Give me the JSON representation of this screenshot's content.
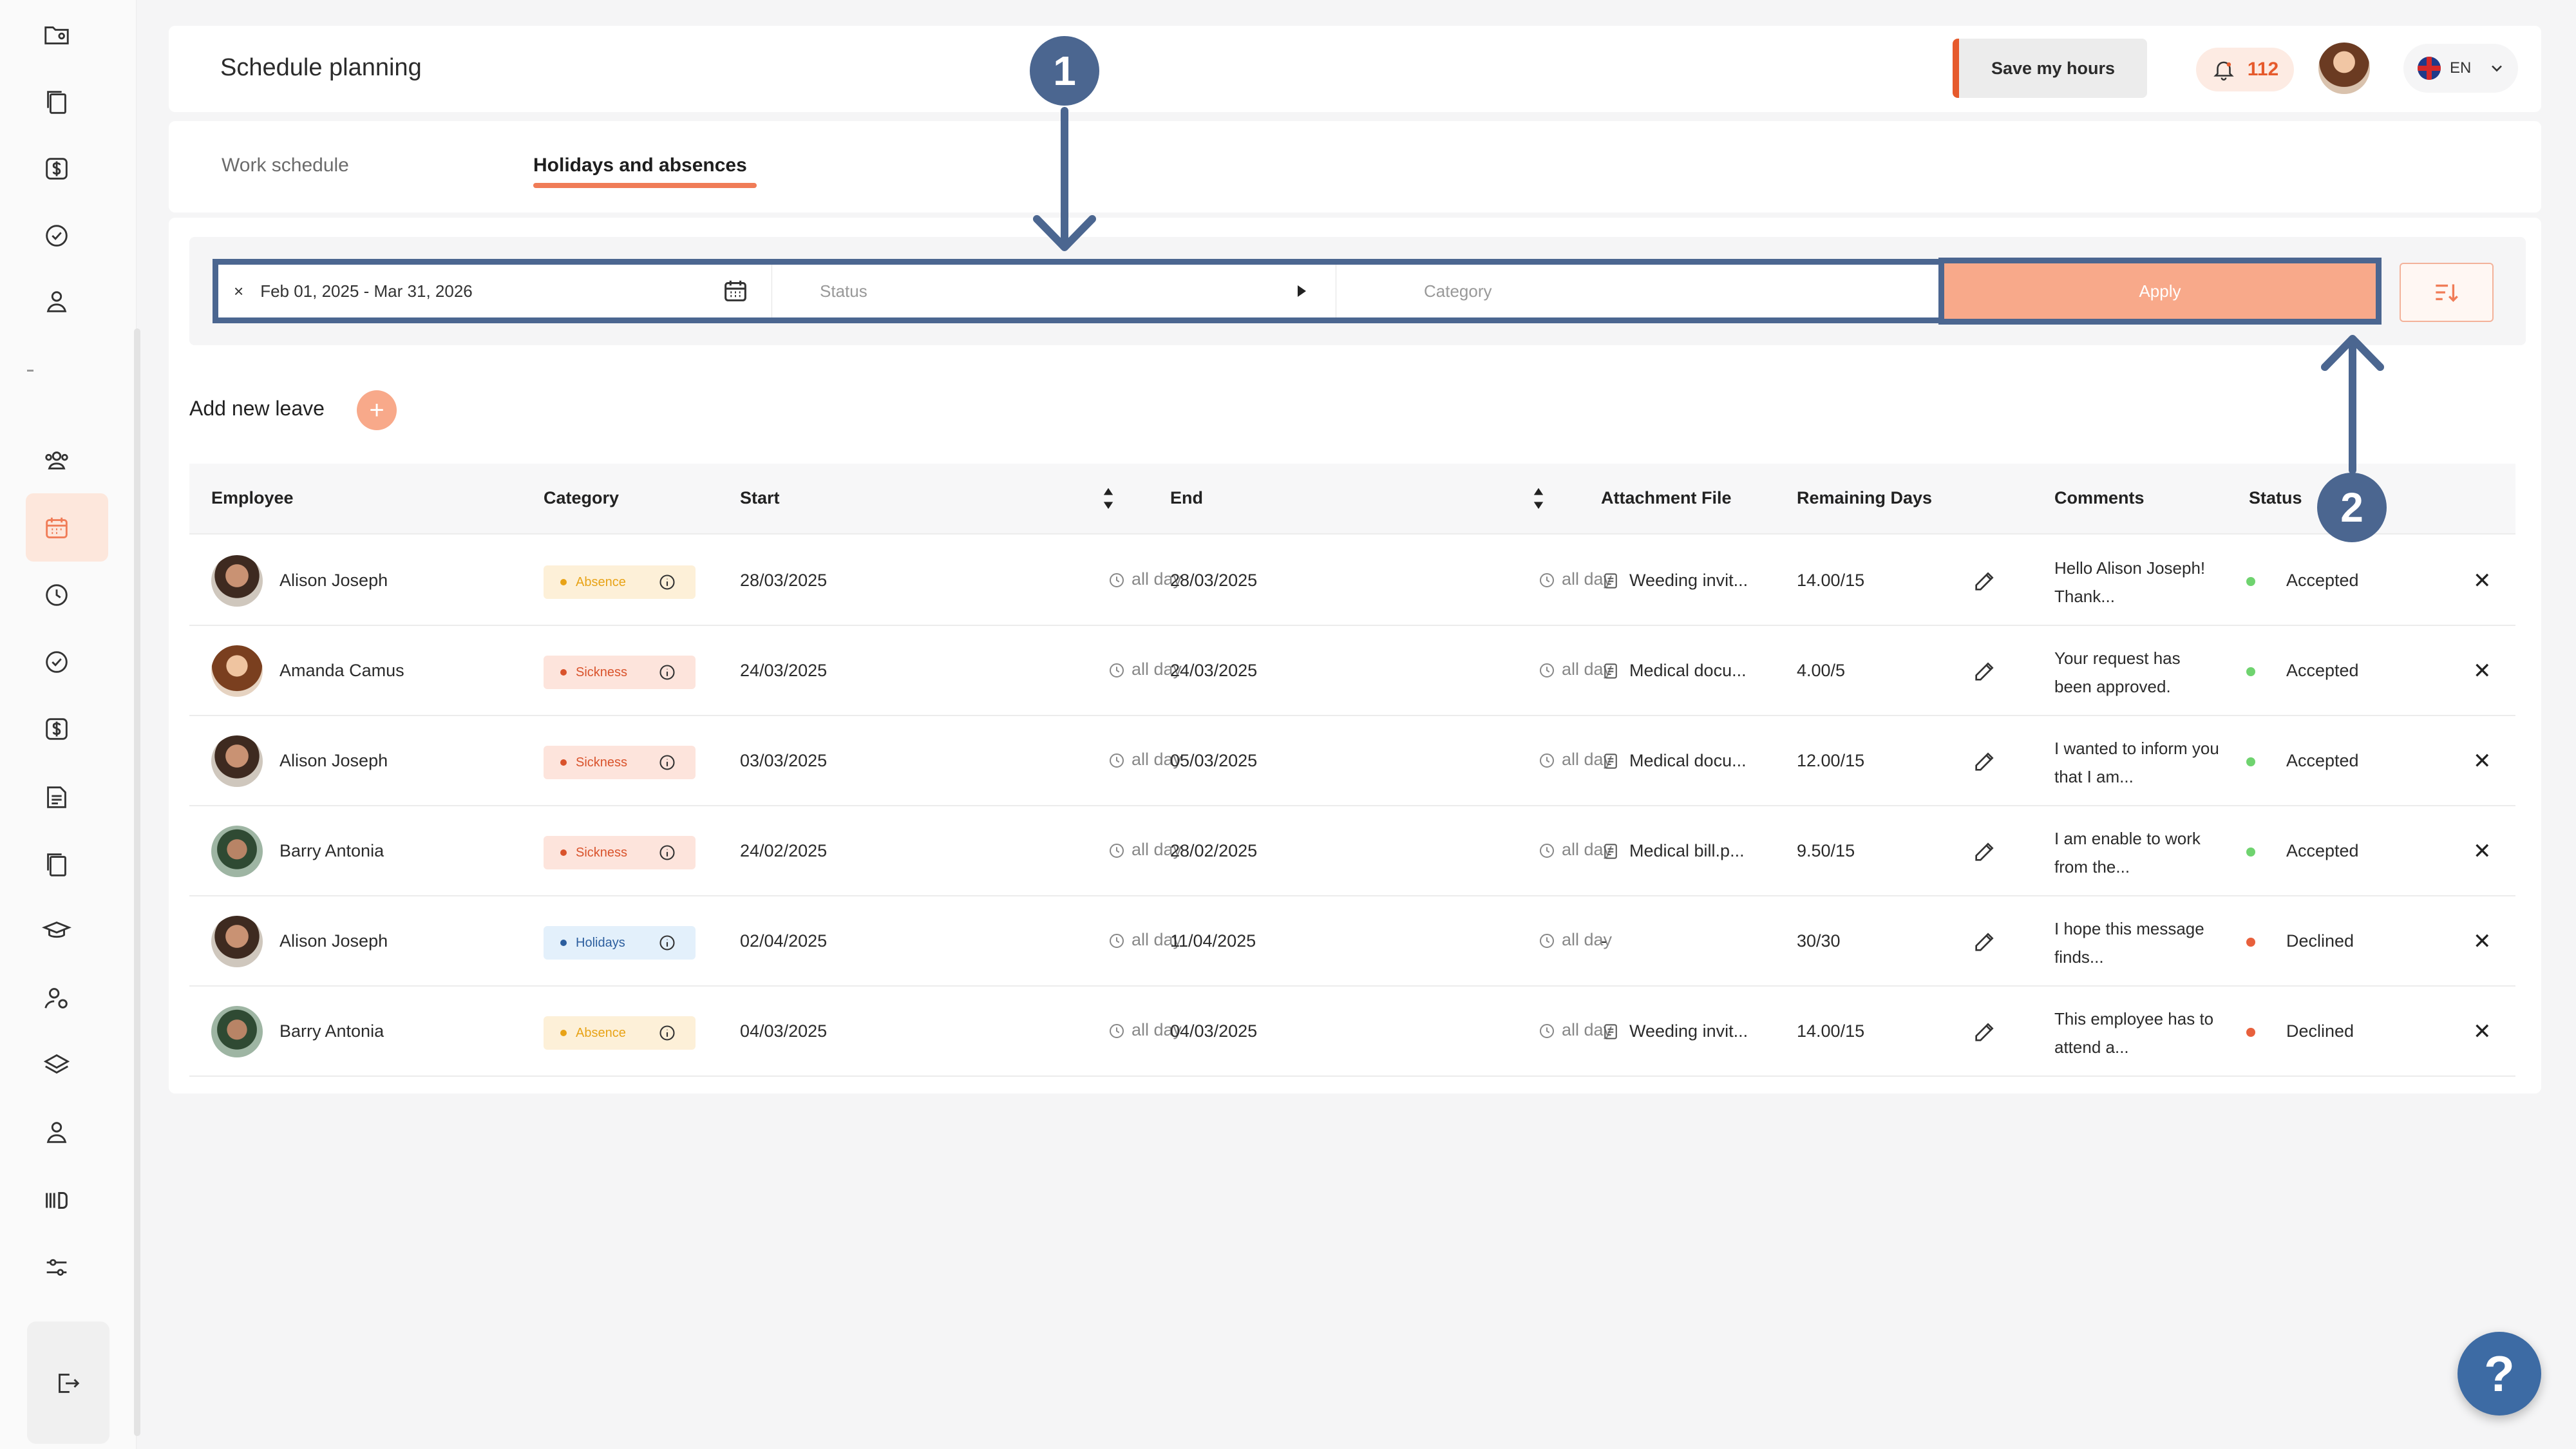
{
  "header": {
    "title": "Schedule planning",
    "save_hours_label": "Save my hours",
    "notification_count": "112",
    "language": "EN"
  },
  "tabs": [
    {
      "label": "Work schedule",
      "active": false
    },
    {
      "label": "Holidays and absences",
      "active": true
    }
  ],
  "filters": {
    "date_range": "Feb 01, 2025 - Mar 31, 2026",
    "status_placeholder": "Status",
    "category_placeholder": "Category",
    "apply_label": "Apply"
  },
  "add_leave_label": "Add new leave",
  "table": {
    "columns": [
      "Employee",
      "Category",
      "Start",
      "End",
      "Attachment File",
      "Remaining Days",
      "Comments",
      "Status"
    ],
    "rows": [
      {
        "employee": "Alison Joseph",
        "category": "Absence",
        "start": "28/03/2025",
        "start_time": "all day",
        "end": "28/03/2025",
        "end_time": "all day",
        "file": "Weeding invit...",
        "remaining": "14.00/15",
        "comment": "Hello Alison Joseph! Thank...",
        "status": "Accepted"
      },
      {
        "employee": "Amanda Camus",
        "category": "Sickness",
        "start": "24/03/2025",
        "start_time": "all day",
        "end": "24/03/2025",
        "end_time": "all day",
        "file": "Medical docu...",
        "remaining": "4.00/5",
        "comment": "Your request has been approved.",
        "status": "Accepted"
      },
      {
        "employee": "Alison Joseph",
        "category": "Sickness",
        "start": "03/03/2025",
        "start_time": "all day",
        "end": "05/03/2025",
        "end_time": "all day",
        "file": "Medical docu...",
        "remaining": "12.00/15",
        "comment": "I wanted to inform you that I am...",
        "status": "Accepted"
      },
      {
        "employee": "Barry Antonia",
        "category": "Sickness",
        "start": "24/02/2025",
        "start_time": "all day",
        "end": "28/02/2025",
        "end_time": "all day",
        "file": "Medical bill.p...",
        "remaining": "9.50/15",
        "comment": "I am enable to work from the...",
        "status": "Accepted"
      },
      {
        "employee": "Alison Joseph",
        "category": "Holidays",
        "start": "02/04/2025",
        "start_time": "all day",
        "end": "11/04/2025",
        "end_time": "all day",
        "file": "-",
        "remaining": "30/30",
        "comment": "I hope this message finds...",
        "status": "Declined"
      },
      {
        "employee": "Barry Antonia",
        "category": "Absence",
        "start": "04/03/2025",
        "start_time": "all day",
        "end": "04/03/2025",
        "end_time": "all day",
        "file": "Weeding invit...",
        "remaining": "14.00/15",
        "comment": "This employee has to attend a...",
        "status": "Declined"
      }
    ]
  },
  "annotations": {
    "badge_1": "1",
    "badge_2": "2"
  },
  "help_label": "?",
  "colors": {
    "accent": "#f07c57",
    "annotation": "#4b6690",
    "accepted": "#6fd36f",
    "declined": "#e8603c",
    "absence_bg": "#fdf0d8",
    "sickness_bg": "#fde4dc",
    "holidays_bg": "#e3f0fb"
  }
}
